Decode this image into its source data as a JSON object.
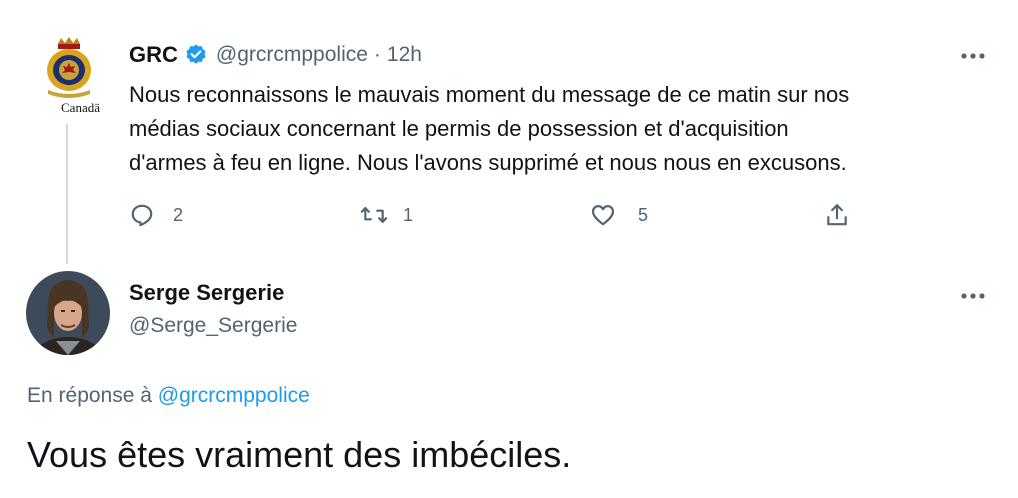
{
  "tweet": {
    "account_name": "GRC",
    "verified": true,
    "handle": "@grcrcmppolice",
    "separator": "·",
    "time": "12h",
    "logo_text": "Canadä",
    "text_lines": [
      "Nous reconnaissons le mauvais moment du message de ce matin sur nos",
      "médias sociaux concernant le permis de possession et d'acquisition",
      "d'armes à feu en ligne. Nous l'avons supprimé et nous nous en excusons."
    ],
    "replies": "2",
    "retweets": "1",
    "likes": "5"
  },
  "reply": {
    "account_name": "Serge Sergerie",
    "handle": "@Serge_Sergerie",
    "replying_prefix": "En réponse à",
    "replying_to": "@grcrcmppolice",
    "text": "Vous êtes vraiment des imbéciles."
  },
  "icons": {
    "more": "more-horizontal-icon",
    "verified": "verified-badge-icon",
    "reply": "reply-icon",
    "retweet": "retweet-icon",
    "like": "heart-icon",
    "share": "share-icon"
  },
  "colors": {
    "text": "#0f1419",
    "secondary": "#536471",
    "accent": "#1d9bf0",
    "thread_line": "#cfd9de"
  }
}
